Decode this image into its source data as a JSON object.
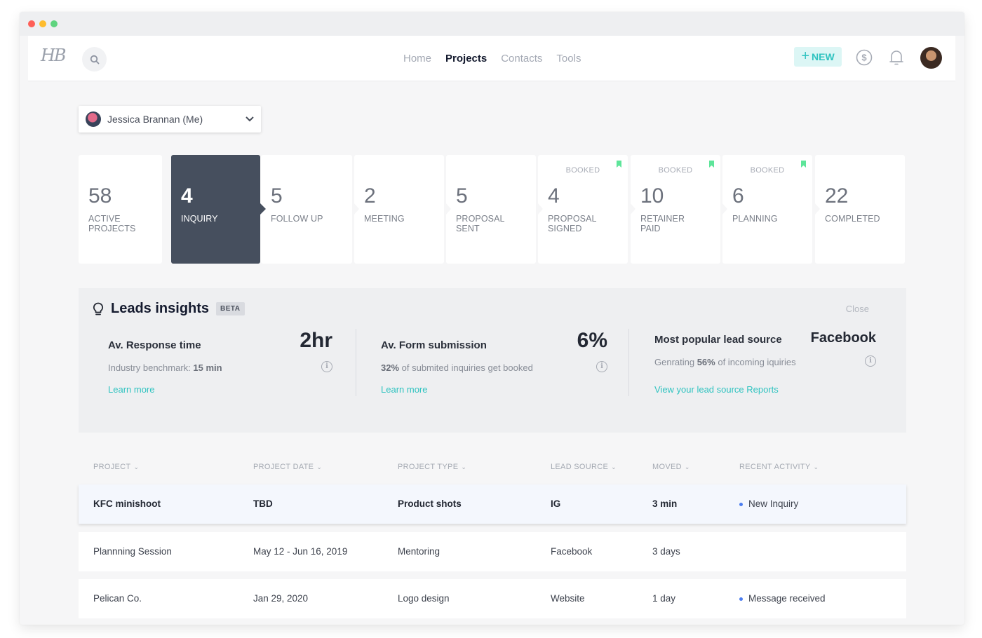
{
  "window": {
    "controls": [
      "close",
      "minimize",
      "maximize"
    ]
  },
  "nav": {
    "logo": "HB",
    "search_icon": "search-icon",
    "links": [
      {
        "label": "Home",
        "active": false
      },
      {
        "label": "Projects",
        "active": true
      },
      {
        "label": "Contacts",
        "active": false
      },
      {
        "label": "Tools",
        "active": false
      }
    ],
    "new_button": {
      "icon": "+",
      "label": "NEW"
    },
    "icons": [
      "dollar-icon",
      "bell-icon",
      "avatar"
    ]
  },
  "user_select": {
    "value": "Jessica Brannan (Me)"
  },
  "pipeline": [
    {
      "count": "58",
      "label": "ACTIVE PROJECTS",
      "booked": null,
      "active": false
    },
    {
      "count": "4",
      "label": "INQUIRY",
      "booked": null,
      "active": true
    },
    {
      "count": "5",
      "label": "FOLLOW UP",
      "booked": null,
      "active": false
    },
    {
      "count": "2",
      "label": "MEETING",
      "booked": null,
      "active": false
    },
    {
      "count": "5",
      "label": "PROPOSAL SENT",
      "booked": null,
      "active": false
    },
    {
      "count": "4",
      "label": "PROPOSAL SIGNED",
      "booked": "BOOKED",
      "active": false
    },
    {
      "count": "10",
      "label": "RETAINER PAID",
      "booked": "BOOKED",
      "active": false
    },
    {
      "count": "6",
      "label": "PLANNING",
      "booked": "BOOKED",
      "active": false
    },
    {
      "count": "22",
      "label": "COMPLETED",
      "booked": null,
      "active": false
    }
  ],
  "insights": {
    "title": "Leads insights",
    "badge": "BETA",
    "close_label": "Close",
    "cards": [
      {
        "heading": "Av. Response time",
        "value": "2hr",
        "sub_prefix": "Industry benchmark: ",
        "sub_bold": "15 min",
        "sub_suffix": "",
        "link": "Learn more"
      },
      {
        "heading": "Av. Form submission",
        "value": "6%",
        "sub_prefix": "",
        "sub_bold": "32%",
        "sub_suffix": " of submited inquiries get booked",
        "link": "Learn more"
      },
      {
        "heading": "Most popular lead source",
        "value": "Facebook",
        "sub_prefix": "Genrating ",
        "sub_bold": "56%",
        "sub_suffix": " of incoming iquiries",
        "link": "View your lead source Reports"
      }
    ]
  },
  "table": {
    "columns": [
      "PROJECT",
      "PROJECT DATE",
      "PROJECT TYPE",
      "LEAD SOURCE",
      "MOVED",
      "RECENT ACTIVITY"
    ],
    "rows": [
      {
        "project": "KFC minishoot",
        "date": "TBD",
        "type": "Product shots",
        "source": "IG",
        "moved": "3 min",
        "activity": "New Inquiry",
        "highlighted": true
      },
      {
        "project": "Plannning Session",
        "date": "May 12 - Jun 16, 2019",
        "type": "Mentoring",
        "source": "Facebook",
        "moved": "3 days",
        "activity": "",
        "highlighted": false
      },
      {
        "project": "Pelican Co.",
        "date": "Jan 29, 2020",
        "type": "Logo design",
        "source": "Website",
        "moved": "1 day",
        "activity": "Message received",
        "highlighted": false
      }
    ]
  },
  "colors": {
    "accent": "#2fc3c0",
    "active_stage": "#464f5e",
    "booked_flag": "#5ee59a",
    "activity_dot": "#4b7df0"
  }
}
